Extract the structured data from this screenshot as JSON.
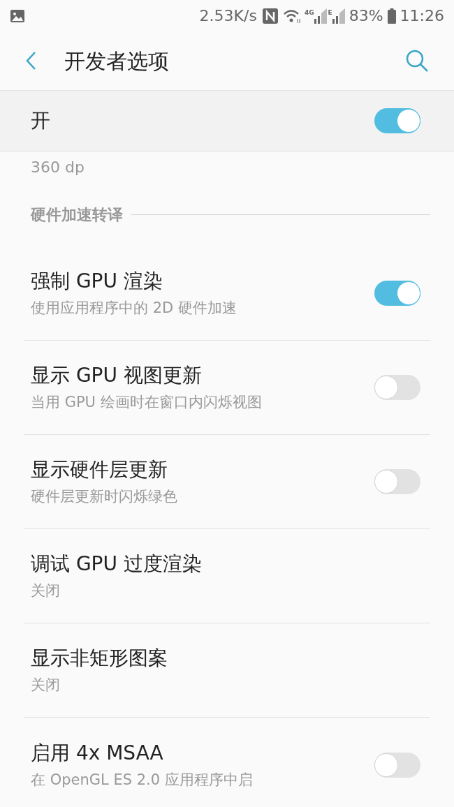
{
  "status_bar": {
    "speed": "2.53K/s",
    "network_labels": [
      "4G",
      "E"
    ],
    "battery": "83%",
    "time": "11:26"
  },
  "toolbar": {
    "title": "开发者选项"
  },
  "master_switch": {
    "label": "开",
    "on": true
  },
  "partial_value": "360 dp",
  "section": {
    "title": "硬件加速转译"
  },
  "items": [
    {
      "kind": "toggle",
      "title": "强制 GPU 渲染",
      "subtitle": "使用应用程序中的 2D 硬件加速",
      "on": true
    },
    {
      "kind": "toggle",
      "title": "显示 GPU 视图更新",
      "subtitle": "当用 GPU 绘画时在窗口内闪烁视图",
      "on": false
    },
    {
      "kind": "toggle",
      "title": "显示硬件层更新",
      "subtitle": "硬件层更新时闪烁绿色",
      "on": false
    },
    {
      "kind": "value",
      "title": "调试 GPU 过度渲染",
      "subtitle": "关闭"
    },
    {
      "kind": "value",
      "title": "显示非矩形图案",
      "subtitle": "关闭"
    },
    {
      "kind": "toggle",
      "title": "启用 4x MSAA",
      "subtitle": "在 OpenGL ES 2.0 应用程序中启",
      "on": false
    }
  ]
}
